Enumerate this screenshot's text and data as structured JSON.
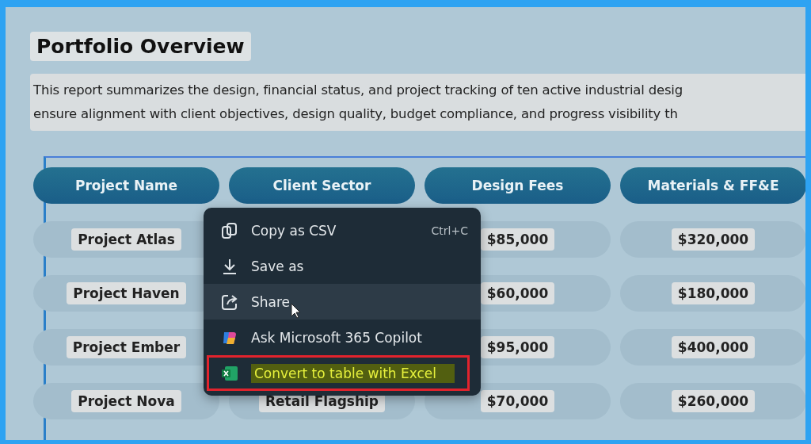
{
  "title": "Portfolio Overview",
  "description": [
    "This report summarizes the design, financial status, and project tracking of ten active industrial desig",
    "ensure alignment with client objectives, design quality, budget compliance, and progress visibility th"
  ],
  "table": {
    "columns": [
      "Project Name",
      "Client Sector",
      "Design Fees",
      "Materials & FF&E"
    ],
    "rows": [
      {
        "project_name": "Project Atlas",
        "design_fees": "$85,000",
        "materials": "$320,000"
      },
      {
        "project_name": "Project Haven",
        "design_fees": "$60,000",
        "materials": "$180,000"
      },
      {
        "project_name": "Project Ember",
        "design_fees": "$95,000",
        "materials": "$400,000"
      },
      {
        "project_name": "Project Nova",
        "client_sector": "Retail Flagship",
        "design_fees": "$70,000",
        "materials": "$260,000"
      }
    ]
  },
  "context_menu": {
    "items": [
      {
        "kind": "copy",
        "label": "Copy as CSV",
        "shortcut": "Ctrl+C",
        "hovered": false,
        "highlighted": false
      },
      {
        "kind": "save",
        "label": "Save as",
        "hovered": false,
        "highlighted": false
      },
      {
        "kind": "share",
        "label": "Share",
        "hovered": true,
        "highlighted": false
      },
      {
        "kind": "copilot",
        "label": "Ask Microsoft 365 Copilot",
        "hovered": false,
        "highlighted": false
      },
      {
        "kind": "excel",
        "label": "Convert to table with Excel",
        "hovered": false,
        "highlighted": true
      }
    ]
  }
}
